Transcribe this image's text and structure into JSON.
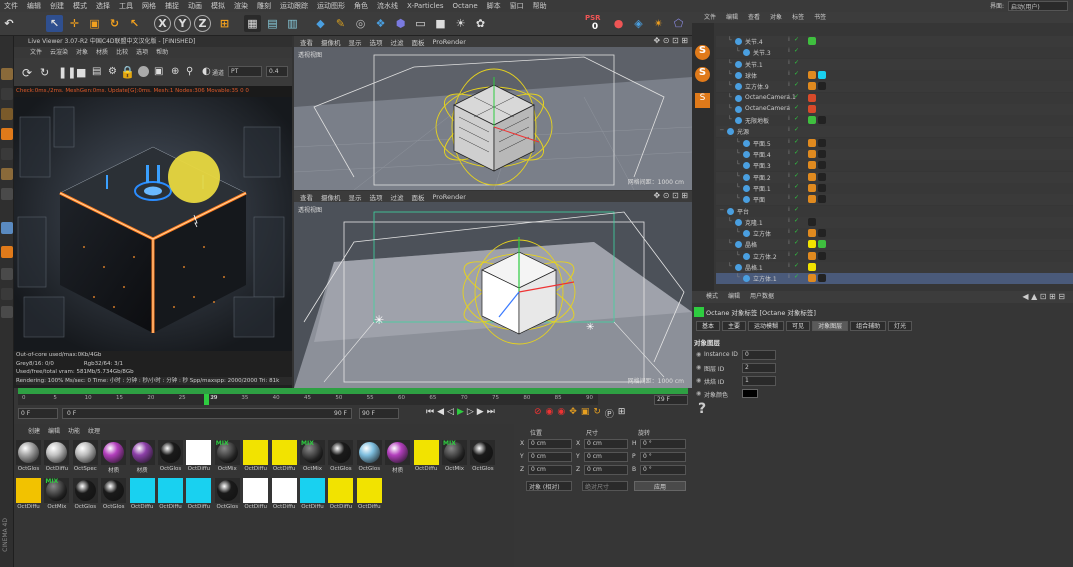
{
  "menu_bar": {
    "items": [
      "文件",
      "编辑",
      "创建",
      "模式",
      "选择",
      "工具",
      "网格",
      "捕捉",
      "动画",
      "模拟",
      "渲染",
      "雕刻",
      "运动跟踪",
      "运动图形",
      "角色",
      "流水线",
      "X-Particles",
      "Octane",
      "脚本",
      "窗口",
      "帮助"
    ],
    "right": [
      "界面:",
      "启动(用户)"
    ]
  },
  "toolbar": {
    "psr": "PSR",
    "psr_value": "0"
  },
  "live_viewer": {
    "title": "Live Viewer 3.07-R2 中国C4D联盟中文汉化版",
    "status": "[FINISHED]",
    "menu": [
      "文件",
      "云渲染",
      "对象",
      "材质",
      "比较",
      "选项",
      "帮助"
    ],
    "kernel_label": "通道",
    "kernel_value": "PT",
    "value_box": "0.4",
    "stats_line": "Check:0ms./2ms. MeshGen:0ms. Update[G]:0ms. Mesh:1 Nodes:306 Movable:35  0 0",
    "bottom": {
      "line1": "Out-of-core used/max:0Kb/4Gb",
      "line2a": "Grey8/16: 0/0",
      "line2b": "Rgb32/64: 3/1",
      "line3": "Used/free/total vram: 581Mb/5.734Gb/8Gb",
      "line4": "Rendering: 100%   Ms/sec: 0   Time: 小时 : 分钟 : 秒/小时 : 分钟 : 秒   Spp/maxspp: 2000/2000  Tri: 81k"
    }
  },
  "viewport_top": {
    "menu": [
      "查看",
      "摄像机",
      "显示",
      "选项",
      "过滤",
      "面板",
      "ProRender"
    ],
    "label": "透视视图",
    "distance": "网格间距：1000 cm"
  },
  "viewport_bottom": {
    "menu": [
      "查看",
      "摄像机",
      "显示",
      "选项",
      "过滤",
      "面板",
      "ProRender"
    ],
    "label": "透视视图",
    "distance": "网格间距：1000 cm"
  },
  "timeline": {
    "ticks": [
      "0",
      "5",
      "10",
      "15",
      "20",
      "25",
      "30",
      "35",
      "40",
      "45",
      "50",
      "55",
      "60",
      "65",
      "70",
      "75",
      "80",
      "85",
      "90"
    ],
    "current_frame": "29",
    "frame_right": "29 F",
    "start": "0 F",
    "range_start": "0 F",
    "range_end": "90 F",
    "end": "90 F",
    "current_pct": 0.32
  },
  "materials": {
    "menu": [
      "创建",
      "编辑",
      "功能",
      "纹理"
    ],
    "row1": [
      {
        "label": "OctGlos",
        "color": "#a5a5a5",
        "kind": "sphere"
      },
      {
        "label": "OctDiffu",
        "color": "#c2c2c2",
        "kind": "sphere"
      },
      {
        "label": "OctSpec",
        "color": "#bdbdbd",
        "kind": "sphere"
      },
      {
        "label": "材质",
        "color": "#b33fbd",
        "kind": "sphere"
      },
      {
        "label": "材质",
        "color": "#8c3fa8",
        "kind": "sphere"
      },
      {
        "label": "OctGlos",
        "color": "#1a1a1a",
        "kind": "sphere"
      },
      {
        "label": "OctDiffu",
        "color": "#ffffff",
        "kind": "flat"
      },
      {
        "label": "OctMix",
        "color": "#2a2a2a",
        "kind": "mix"
      },
      {
        "label": "OctDiffu",
        "color": "#f2e300",
        "kind": "flat"
      },
      {
        "label": "OctDiffu",
        "color": "#f2e300",
        "kind": "flat"
      },
      {
        "label": "OctMix",
        "color": "#2a2a2a",
        "kind": "mix"
      },
      {
        "label": "OctGlos",
        "color": "#1a1a1a",
        "kind": "sphere"
      },
      {
        "label": "OctGlos",
        "color": "#7fbfdf",
        "kind": "sphere"
      },
      {
        "label": "材质",
        "color": "#b33fbd",
        "kind": "sphere"
      },
      {
        "label": "OctDiffu",
        "color": "#f2e300",
        "kind": "flat"
      },
      {
        "label": "OctMix",
        "color": "#2a2a2a",
        "kind": "mix"
      },
      {
        "label": "OctGlos",
        "color": "#1a1a1a",
        "kind": "sphere"
      }
    ],
    "row2": [
      {
        "label": "OctDiffu",
        "color": "#f2c200",
        "kind": "flat"
      },
      {
        "label": "OctMix",
        "color": "#2a2a2a",
        "kind": "mix"
      },
      {
        "label": "OctGlos",
        "color": "#1a1a1a",
        "kind": "sphere"
      },
      {
        "label": "OctGlos",
        "color": "#1a1a1a",
        "kind": "sphere"
      },
      {
        "label": "OctDiffu",
        "color": "#19d1f0",
        "kind": "flat"
      },
      {
        "label": "OctDiffu",
        "color": "#19d1f0",
        "kind": "flat"
      },
      {
        "label": "OctDiffu",
        "color": "#19d1f0",
        "kind": "flat"
      },
      {
        "label": "OctGlos",
        "color": "#1a1a1a",
        "kind": "sphere"
      },
      {
        "label": "OctDiffu",
        "color": "#ffffff",
        "kind": "flat"
      },
      {
        "label": "OctDiffu",
        "color": "#ffffff",
        "kind": "flat"
      },
      {
        "label": "OctDiffu",
        "color": "#19d1f0",
        "kind": "flat"
      },
      {
        "label": "OctDiffu",
        "color": "#f2e300",
        "kind": "flat"
      },
      {
        "label": "OctDiffu",
        "color": "#f2e300",
        "kind": "flat"
      }
    ]
  },
  "coords": {
    "headers": [
      "位置",
      "尺寸",
      "旋转"
    ],
    "rows": [
      {
        "axis": "X",
        "pos": "0 cm",
        "saxis": "X",
        "size": "0 cm",
        "raxis": "H",
        "rot": "0 °"
      },
      {
        "axis": "Y",
        "pos": "0 cm",
        "saxis": "Y",
        "size": "0 cm",
        "raxis": "P",
        "rot": "0 °"
      },
      {
        "axis": "Z",
        "pos": "0 cm",
        "saxis": "Z",
        "size": "0 cm",
        "raxis": "B",
        "rot": "0 °"
      }
    ],
    "mode1": "对象 (相对)",
    "mode2": "绝对尺寸",
    "apply": "应用"
  },
  "object_manager": {
    "menu": [
      "文件",
      "编辑",
      "查看",
      "对象",
      "标签",
      "书签"
    ],
    "objects": [
      {
        "name": "关节.4",
        "indent": 1,
        "sel": false,
        "tags": [
          "#3fbf3f"
        ]
      },
      {
        "name": "关节.3",
        "indent": 2,
        "sel": false,
        "tags": []
      },
      {
        "name": "关节.1",
        "indent": 1,
        "sel": false,
        "tags": []
      },
      {
        "name": "球体",
        "indent": 1,
        "sel": false,
        "tags": [
          "#e08a1f",
          "#19d1f0"
        ]
      },
      {
        "name": "立方体.9",
        "indent": 1,
        "sel": false,
        "tags": [
          "#e08a1f",
          "#222222"
        ]
      },
      {
        "name": "OctaneCamera.1",
        "indent": 1,
        "sel": false,
        "tags": [
          "#d84a2a"
        ]
      },
      {
        "name": "OctaneCamera",
        "indent": 1,
        "sel": false,
        "tags": [
          "#d84a2a"
        ]
      },
      {
        "name": "无限地板",
        "indent": 1,
        "sel": false,
        "tags": [
          "#3fbf3f",
          "#222222"
        ]
      },
      {
        "name": "光源",
        "indent": 0,
        "sel": false,
        "tags": []
      },
      {
        "name": "平面.5",
        "indent": 2,
        "sel": false,
        "tags": [
          "#e08a1f",
          "#222222"
        ]
      },
      {
        "name": "平面.4",
        "indent": 2,
        "sel": false,
        "tags": [
          "#e08a1f",
          "#222222"
        ]
      },
      {
        "name": "平面.3",
        "indent": 2,
        "sel": false,
        "tags": [
          "#e08a1f",
          "#222222"
        ]
      },
      {
        "name": "平面.2",
        "indent": 2,
        "sel": false,
        "tags": [
          "#e08a1f",
          "#222222"
        ]
      },
      {
        "name": "平面.1",
        "indent": 2,
        "sel": false,
        "tags": [
          "#e08a1f",
          "#222222"
        ]
      },
      {
        "name": "平面",
        "indent": 2,
        "sel": false,
        "tags": [
          "#e08a1f",
          "#222222"
        ]
      },
      {
        "name": "平台",
        "indent": 0,
        "sel": false,
        "tags": []
      },
      {
        "name": "克隆.1",
        "indent": 1,
        "sel": false,
        "tags": [
          "#222222"
        ]
      },
      {
        "name": "立方体",
        "indent": 2,
        "sel": false,
        "tags": [
          "#e08a1f",
          "#222222"
        ]
      },
      {
        "name": "晶格",
        "indent": 1,
        "sel": false,
        "tags": [
          "#f2e300",
          "#3fbf3f"
        ]
      },
      {
        "name": "立方体.2",
        "indent": 2,
        "sel": false,
        "tags": [
          "#e08a1f",
          "#222222"
        ]
      },
      {
        "name": "晶格.1",
        "indent": 1,
        "sel": false,
        "tags": [
          "#f2e300"
        ]
      },
      {
        "name": "立方体.1",
        "indent": 2,
        "sel": true,
        "tags": [
          "#e08a1f",
          "#222222"
        ]
      }
    ]
  },
  "attributes": {
    "menu": [
      "模式",
      "编辑",
      "用户数据"
    ],
    "title": "Octane 对象标签 [Octane 对象标签]",
    "tabs": [
      "基本",
      "主要",
      "运动模糊",
      "可见",
      "对象图层",
      "组合辅助",
      "灯光"
    ],
    "active_tab": 4,
    "section": "对象图层",
    "fields": [
      {
        "label": "Instance ID",
        "value": "0"
      },
      {
        "label": "图层 ID",
        "value": "2"
      },
      {
        "label": "烘焙 ID",
        "value": "1"
      },
      {
        "label": "对象颜色",
        "value": ""
      }
    ],
    "help": "?"
  },
  "side": {
    "vertical_label": "CINEMA 4D"
  }
}
